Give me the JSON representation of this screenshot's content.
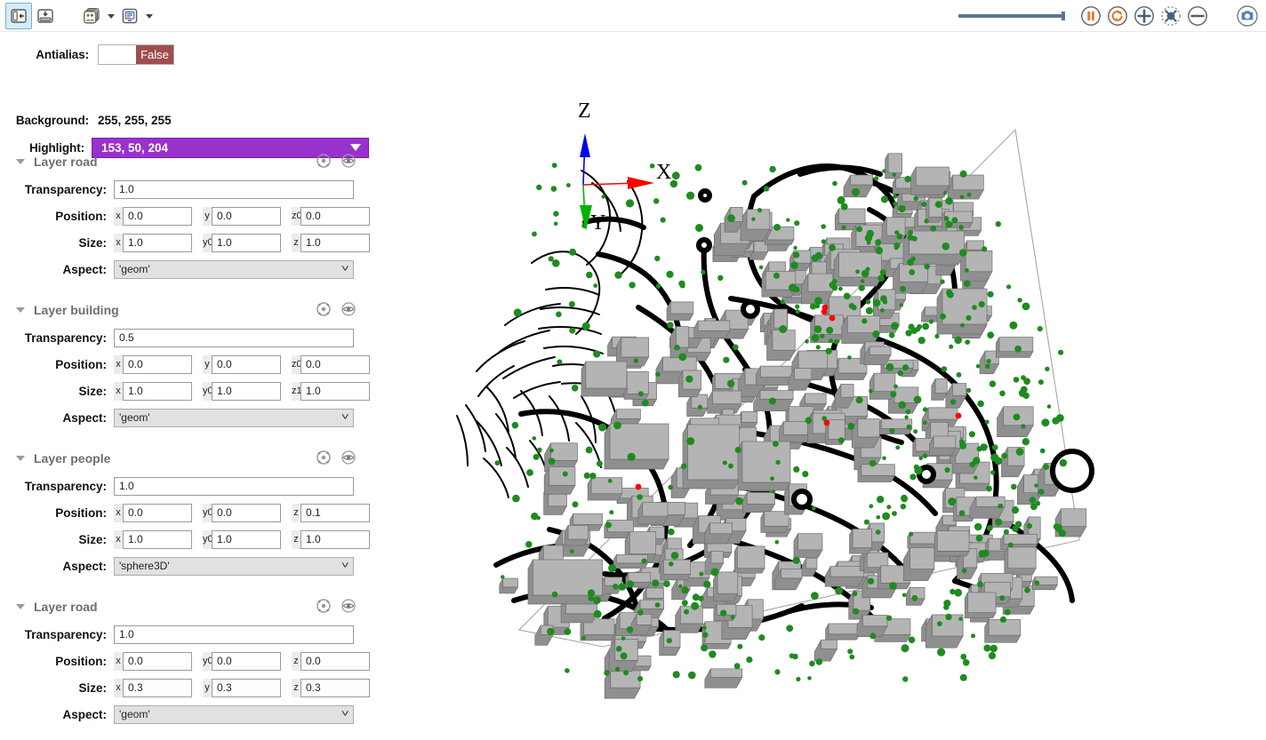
{
  "toolbar": {
    "left_buttons": [
      {
        "name": "toggle-side-panel",
        "icon": "panel-left-icon",
        "active": true
      },
      {
        "name": "toggle-bottom-panel",
        "icon": "panel-bottom-icon",
        "active": false
      },
      {
        "name": "agents-menu",
        "icon": "agents-icon",
        "active": false
      },
      {
        "name": "display-menu",
        "icon": "display-list-icon",
        "active": false
      }
    ],
    "right_buttons": [
      {
        "name": "pause-button",
        "icon": "pause-icon",
        "color": "#e07b28"
      },
      {
        "name": "sync-button",
        "icon": "sync-icon",
        "color": "#e07b28"
      },
      {
        "name": "zoom-in-button",
        "icon": "plus-icon",
        "color": "#46617e"
      },
      {
        "name": "zoom-fit-button",
        "icon": "fit-icon",
        "color": "#46617e"
      },
      {
        "name": "zoom-out-button",
        "icon": "minus-icon",
        "color": "#46617e"
      },
      {
        "name": "snapshot-button",
        "icon": "camera-icon",
        "color": "#5a7fb5"
      }
    ],
    "slider": {
      "name": "opacity-slider",
      "value": 100
    }
  },
  "sidebar": {
    "antialias": {
      "label": "Antialias:",
      "value": "False"
    },
    "background": {
      "label": "Background:",
      "value": "255, 255, 255"
    },
    "highlight": {
      "label": "Highlight:",
      "value": "153, 50, 204",
      "color": "#9932cc"
    },
    "field_labels": {
      "transparency": "Transparency:",
      "position": "Position:",
      "size": "Size:",
      "aspect": "Aspect:"
    },
    "layers": [
      {
        "title": "Layer road",
        "transparency": "1.0",
        "position": {
          "x_label": "x",
          "x": "0.0",
          "y_label": "y",
          "y": "0.0",
          "z_label": "z0",
          "z": "0.0"
        },
        "size": {
          "x_label": "x",
          "x": "1.0",
          "y_label": "y0",
          "y": "1.0",
          "z_label": "z",
          "z": "1.0"
        },
        "aspect": "'geom'"
      },
      {
        "title": "Layer building",
        "transparency": "0.5",
        "position": {
          "x_label": "x",
          "x": "0.0",
          "y_label": "y",
          "y": "0.0",
          "z_label": "z0",
          "z": "0.0"
        },
        "size": {
          "x_label": "x",
          "x": "1.0",
          "y_label": "y0",
          "y": "1.0",
          "z_label": "z1",
          "z": "1.0"
        },
        "aspect": "'geom'"
      },
      {
        "title": "Layer people",
        "transparency": "1.0",
        "position": {
          "x_label": "x",
          "x": "0.0",
          "y_label": "y0",
          "y": "0.0",
          "z_label": "z",
          "z": "0.1"
        },
        "size": {
          "x_label": "x",
          "x": "1.0",
          "y_label": "y0",
          "y": "1.0",
          "z_label": "z",
          "z": "1.0"
        },
        "aspect": "'sphere3D'"
      },
      {
        "title": "Layer road",
        "transparency": "1.0",
        "position": {
          "x_label": "x",
          "x": "0.0",
          "y_label": "y0",
          "y": "0.0",
          "z_label": "z",
          "z": "0.0"
        },
        "size": {
          "x_label": "x",
          "x": "0.3",
          "y_label": "y",
          "y": "0.3",
          "z_label": "z",
          "z": "0.3"
        },
        "aspect": "'geom'"
      }
    ]
  },
  "map": {
    "axis_labels": {
      "x": "X",
      "y": "Y",
      "z": "Z"
    },
    "axis_colors": {
      "x": "#ff0000",
      "y": "#00b300",
      "z": "#0000ee"
    },
    "colors": {
      "building_top": "#b4b4b4",
      "building_side": "#8f8f8f",
      "road": "#000000",
      "people": "#1f8b1f",
      "highlight_agent": "#ff0000",
      "ground_outline": "#a6a6a6",
      "background": "#ffffff"
    }
  }
}
